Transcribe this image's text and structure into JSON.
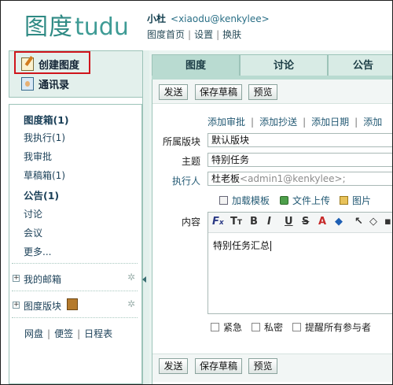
{
  "header": {
    "logo_cn": "图度",
    "logo_en": "tudu",
    "user_name": "小杜",
    "user_email": "<xiaodu@kenkylee>",
    "links": [
      "图度首页",
      "设置",
      "换肤"
    ]
  },
  "sidebar": {
    "create_label": "创建图度",
    "contacts_label": "通讯录",
    "nav": [
      {
        "label": "图度箱(1)",
        "bold": true
      },
      {
        "label": "我执行(1)",
        "bold": false
      },
      {
        "label": "我审批",
        "bold": false
      },
      {
        "label": "草稿箱(1)",
        "bold": false
      },
      {
        "label": "公告(1)",
        "bold": true
      },
      {
        "label": "讨论",
        "bold": false
      },
      {
        "label": "会议",
        "bold": false
      },
      {
        "label": "更多...",
        "bold": false
      }
    ],
    "mailbox_label": "我的邮箱",
    "board_label": "图度版块",
    "bottom_links": [
      "网盘",
      "便签",
      "日程表"
    ]
  },
  "tabs": [
    "图度",
    "讨论",
    "公告"
  ],
  "toolbar": {
    "send": "发送",
    "save_draft": "保存草稿",
    "preview": "预览"
  },
  "add_links": [
    "添加审批",
    "添加抄送",
    "添加日期",
    "添加"
  ],
  "form": {
    "board_label": "所属版块",
    "board_value": "默认版块",
    "subject_label": "主题",
    "subject_value": "特别任务",
    "assignee_label": "执行人",
    "assignee_name": "杜老板",
    "assignee_email": "<admin1@kenkylee>;",
    "content_label": "内容",
    "content_value": "特别任务汇总"
  },
  "attachments": {
    "template": "加载模板",
    "upload": "文件上传",
    "image": "图片"
  },
  "options": [
    "紧急",
    "私密",
    "提醒所有参与者"
  ],
  "colors": {
    "brand": "#2f8a84",
    "panel_bg": "#eaf4f1",
    "highlight_border": "#d0151c"
  }
}
